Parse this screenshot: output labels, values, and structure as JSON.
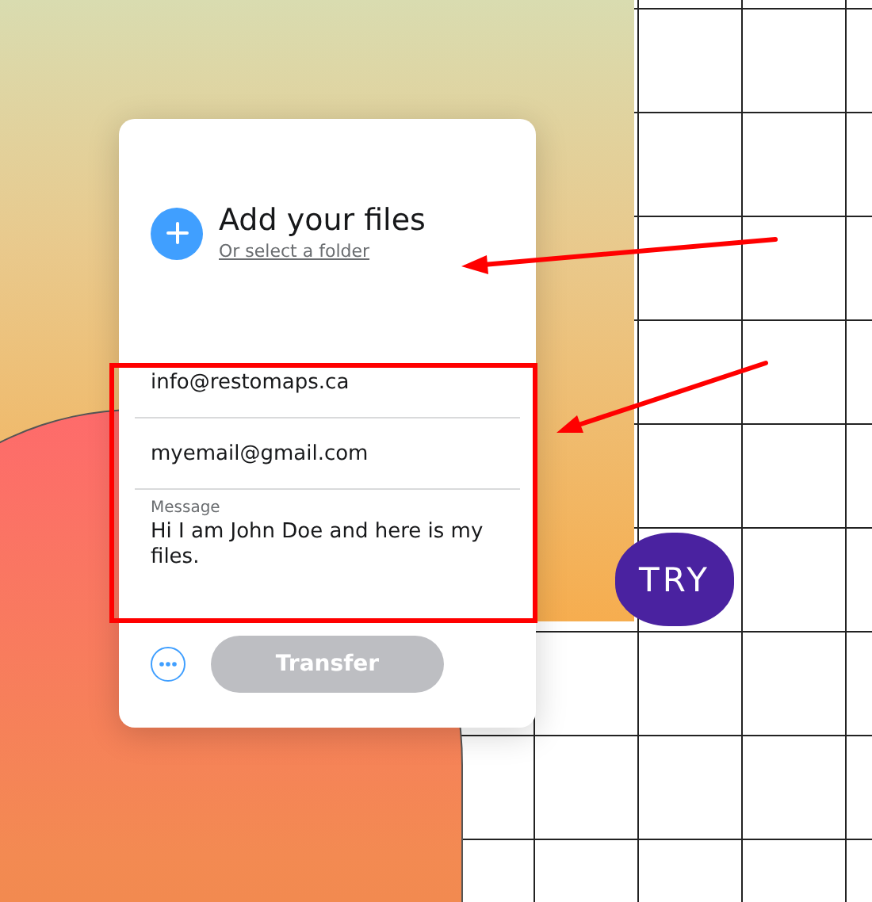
{
  "upload": {
    "title": "Add your files",
    "link": "Or select a folder"
  },
  "fields": [
    {
      "kind": "email",
      "value": "info@restomaps.ca"
    },
    {
      "kind": "email",
      "value": "myemail@gmail.com"
    },
    {
      "kind": "message",
      "label": "Message",
      "value": "Hi I am John Doe and here is my files."
    }
  ],
  "transfer_button": {
    "label": "Transfer",
    "disabled": true
  },
  "badge": {
    "label": "TRY"
  }
}
